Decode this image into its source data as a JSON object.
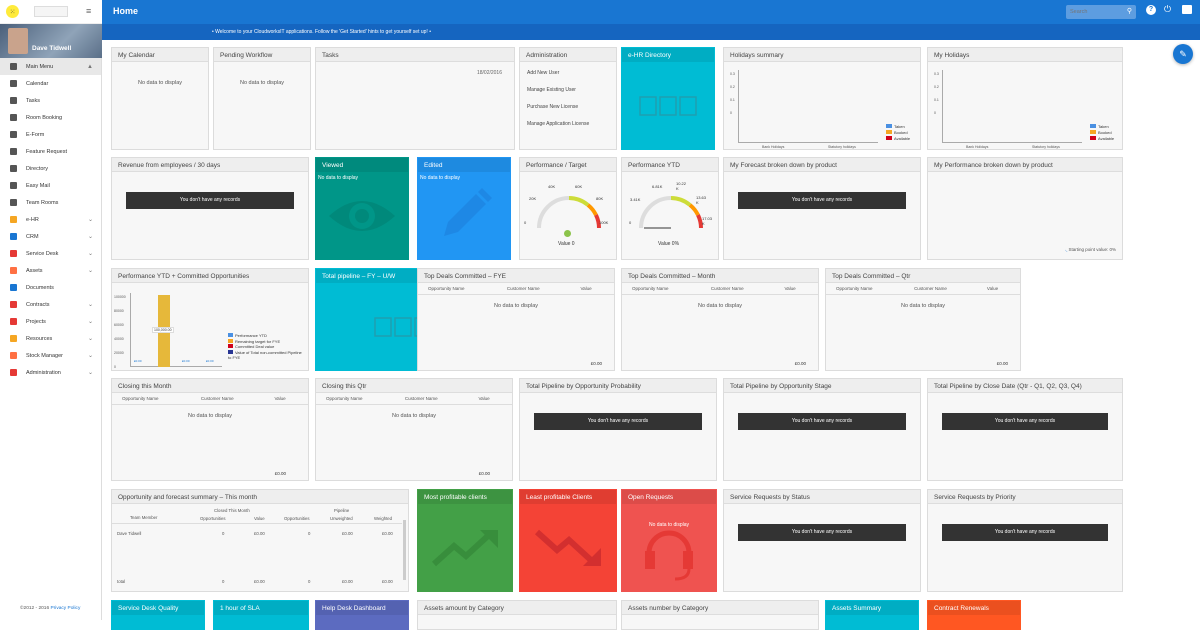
{
  "topbar": {
    "title": "Home",
    "search_placeholder": "Search"
  },
  "welcome": "• Welcome to your CloudworksIT applications. Follow the 'Get Started' hints to get yourself set up! •",
  "sidebar": {
    "user_name": "Dave Tidwell",
    "menu_items": [
      {
        "label": "Main Menu",
        "icon": "grid-icon",
        "chev": "▲",
        "color": "#555"
      },
      {
        "label": "Calendar",
        "icon": "calendar-icon",
        "chev": "",
        "color": "#555"
      },
      {
        "label": "Tasks",
        "icon": "tasks-icon",
        "chev": "",
        "color": "#555"
      },
      {
        "label": "Room Booking",
        "icon": "room-icon",
        "chev": "",
        "color": "#555"
      },
      {
        "label": "E-Form",
        "icon": "form-icon",
        "chev": "",
        "color": "#555"
      },
      {
        "label": "Feature Request",
        "icon": "feature-icon",
        "chev": "",
        "color": "#555"
      },
      {
        "label": "Directory",
        "icon": "directory-icon",
        "chev": "",
        "color": "#555"
      },
      {
        "label": "Easy Mail",
        "icon": "mail-icon",
        "chev": "",
        "color": "#555"
      },
      {
        "label": "Team Rooms",
        "icon": "team-icon",
        "chev": "",
        "color": "#555"
      },
      {
        "label": "e-HR",
        "icon": "ehr-icon",
        "chev": "⌄",
        "color": "#f5a623"
      },
      {
        "label": "CRM",
        "icon": "crm-icon",
        "chev": "⌄",
        "color": "#1976d2"
      },
      {
        "label": "Service Desk",
        "icon": "service-icon",
        "chev": "⌄",
        "color": "#e53935"
      },
      {
        "label": "Assets",
        "icon": "assets-icon",
        "chev": "⌄",
        "color": "#ff7043"
      },
      {
        "label": "Documents",
        "icon": "documents-icon",
        "chev": "",
        "color": "#1976d2"
      },
      {
        "label": "Contracts",
        "icon": "contracts-icon",
        "chev": "⌄",
        "color": "#e53935"
      },
      {
        "label": "Projects",
        "icon": "projects-icon",
        "chev": "⌄",
        "color": "#e53935"
      },
      {
        "label": "Resources",
        "icon": "resources-icon",
        "chev": "⌄",
        "color": "#f5a623"
      },
      {
        "label": "Stock Manager",
        "icon": "stock-icon",
        "chev": "⌄",
        "color": "#ff7043"
      },
      {
        "label": "Administration",
        "icon": "wrench-icon",
        "chev": "⌄",
        "color": "#e53935"
      }
    ],
    "footer_text": "©2012 - 2016",
    "footer_link": "Privacy Policy"
  },
  "widgets": {
    "my_calendar": {
      "title": "My Calendar",
      "body": "No data to display"
    },
    "pending_workflow": {
      "title": "Pending Workflow",
      "body": "No data to display"
    },
    "tasks": {
      "title": "Tasks",
      "date": "18/02/2016"
    },
    "administration": {
      "title": "Administration",
      "links": [
        "Add New User",
        "Manage Existing User",
        "Purchase New License",
        "Manage Application License"
      ]
    },
    "ehr_directory": {
      "title": "e-HR Directory"
    },
    "holidays_summary": {
      "title": "Holidays summary",
      "y_ticks": [
        "0.3",
        "0.2",
        "0.1",
        "0"
      ],
      "x_labels": [
        "Bank Holidays",
        "Statutory holidays"
      ],
      "legend": [
        "Taken",
        "Booked",
        "Available"
      ]
    },
    "my_holidays": {
      "title": "My Holidays",
      "y_ticks": [
        "0.3",
        "0.2",
        "0.1",
        "0"
      ],
      "x_labels": [
        "Bank Holidays",
        "Statutory holidays"
      ],
      "legend": [
        "Taken",
        "Booked",
        "Available"
      ]
    },
    "revenue_employees": {
      "title": "Revenue from employees / 30 days",
      "body": "You don't have any records"
    },
    "viewed": {
      "title": "Viewed",
      "body": "No data to display"
    },
    "edited": {
      "title": "Edited",
      "body": "No data to display"
    },
    "performance_target": {
      "title": "Performance / Target",
      "ticks": [
        "0",
        "20K",
        "40K",
        "60K",
        "80K",
        "100K"
      ],
      "value": "Value 0"
    },
    "performance_ytd": {
      "title": "Performance YTD",
      "ticks": [
        "0",
        "3.41K",
        "6.81K",
        "10.22 K",
        "13.63 K",
        "17.03 K"
      ],
      "value": "Value 0%"
    },
    "forecast_product": {
      "title": "My Forecast broken down by product",
      "body": "You don't have any records"
    },
    "my_performance_product": {
      "title": "My Performance broken down by product",
      "body": "Starting point value: 0%"
    },
    "perf_ytd_committed": {
      "title": "Performance YTD + Committed Opportunities",
      "y_ticks": [
        "100000",
        "80000",
        "60000",
        "40000",
        "20000",
        "0"
      ],
      "legend": [
        "Performance YTD",
        "Remaining target for FYE",
        "Committed Deal value",
        "Value of Total non-committed Pipeline to FYE"
      ],
      "bar_label": "100,000.00",
      "small_labels": [
        "£0.00",
        "£0.00",
        "£0.00",
        "£0.00"
      ]
    },
    "total_pipeline": {
      "title": "Total pipeline – FY – U/W"
    },
    "top_deals_fye": {
      "title": "Top Deals Committed – FYE",
      "cols": [
        "Opportunity Name",
        "Customer Name",
        "Value"
      ],
      "body": "No data to display",
      "total": "£0.00"
    },
    "top_deals_month": {
      "title": "Top Deals Committed – Month",
      "cols": [
        "Opportunity Name",
        "Customer Name",
        "Value"
      ],
      "body": "No data to display",
      "total": "£0.00"
    },
    "top_deals_qtr": {
      "title": "Top Deals Committed – Qtr",
      "cols": [
        "Opportunity Name",
        "Customer Name",
        "Value"
      ],
      "body": "No data to display",
      "total": "£0.00"
    },
    "closing_month": {
      "title": "Closing this Month",
      "cols": [
        "Opportunity Name",
        "Customer Name",
        "Value"
      ],
      "body": "No data to display",
      "total": "£0.00"
    },
    "closing_qtr": {
      "title": "Closing this Qtr",
      "cols": [
        "Opportunity Name",
        "Customer Name",
        "Value"
      ],
      "body": "No data to display",
      "total": "£0.00"
    },
    "pipeline_probability": {
      "title": "Total Pipeline by Opportunity Probability",
      "body": "You don't have any records"
    },
    "pipeline_stage": {
      "title": "Total Pipeline by Opportunity Stage",
      "body": "You don't have any records"
    },
    "pipeline_close": {
      "title": "Total Pipeline by Close Date (Qtr - Q1, Q2, Q3, Q4)",
      "body": "You don't have any records"
    },
    "opp_forecast": {
      "title": "Opportunity and forecast summary – This month",
      "group_headers": [
        "Team Member",
        "Closed This Month",
        "Pipeline"
      ],
      "sub_headers": [
        "Opportunities",
        "Value",
        "Opportunities",
        "Unweighted",
        "Weighted"
      ],
      "row": [
        "Dave Tidwell",
        "0",
        "£0.00",
        "0",
        "£0.00",
        "£0.00"
      ],
      "total_row": [
        "total",
        "0",
        "£0.00",
        "0",
        "£0.00",
        "£0.00"
      ]
    },
    "most_profitable": {
      "title": "Most profitable clients"
    },
    "least_profitable": {
      "title": "Least profitable Clients"
    },
    "open_requests": {
      "title": "Open Requests",
      "body": "No data to display"
    },
    "sr_status": {
      "title": "Service Requests by Status",
      "body": "You don't have any records"
    },
    "sr_priority": {
      "title": "Service Requests by Priority",
      "body": "You don't have any records"
    },
    "service_desk_quality": {
      "title": "Service Desk Quality"
    },
    "hour_sla": {
      "title": "1 hour of SLA"
    },
    "help_desk": {
      "title": "Help Desk Dashboard"
    },
    "assets_amount": {
      "title": "Assets amount by Category"
    },
    "assets_number": {
      "title": "Assets number by Category"
    },
    "assets_summary": {
      "title": "Assets Summary"
    },
    "contract_renewals": {
      "title": "Contract Renewals"
    }
  },
  "colors": {
    "primary": "#1976d2",
    "teal": "#00bcd4",
    "green_teal": "#009688",
    "blue": "#2196f3",
    "green": "#43a047",
    "red": "#f44336",
    "orange": "#ff5722",
    "purple": "#5c6bc0"
  }
}
